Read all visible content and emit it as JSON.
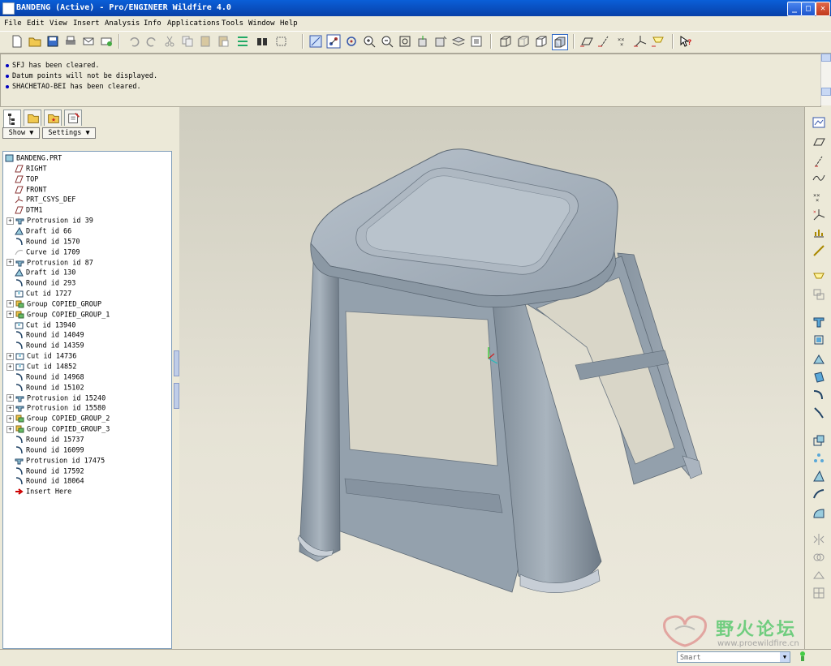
{
  "window": {
    "title": "BANDENG (Active) - Pro/ENGINEER Wildfire 4.0"
  },
  "menu": [
    "File",
    "Edit",
    "View",
    "Insert",
    "Analysis",
    "Info",
    "Applications",
    "Tools",
    "Window",
    "Help"
  ],
  "messages": [
    "SFJ has been cleared.",
    "Datum points will not be displayed.",
    "SHACHETAO-BEI has been cleared."
  ],
  "panel": {
    "show_label": "Show ▼",
    "settings_label": "Settings ▼"
  },
  "tree": [
    {
      "label": "BANDENG.PRT",
      "icon": "part-icon",
      "expand": false,
      "indent": 0
    },
    {
      "label": "RIGHT",
      "icon": "datum-plane-icon",
      "expand": false,
      "indent": 1
    },
    {
      "label": "TOP",
      "icon": "datum-plane-icon",
      "expand": false,
      "indent": 1
    },
    {
      "label": "FRONT",
      "icon": "datum-plane-icon",
      "expand": false,
      "indent": 1
    },
    {
      "label": "PRT_CSYS_DEF",
      "icon": "csys-icon",
      "expand": false,
      "indent": 1
    },
    {
      "label": "DTM1",
      "icon": "datum-plane-icon",
      "expand": false,
      "indent": 1
    },
    {
      "label": "Protrusion id 39",
      "icon": "protrusion-icon",
      "expand": true,
      "indent": 1
    },
    {
      "label": "Draft id 66",
      "icon": "draft-icon",
      "expand": false,
      "indent": 1
    },
    {
      "label": "Round id 1570",
      "icon": "round-icon",
      "expand": false,
      "indent": 1
    },
    {
      "label": "Curve id 1709",
      "icon": "curve-icon",
      "expand": false,
      "indent": 1
    },
    {
      "label": "Protrusion id 87",
      "icon": "protrusion-icon",
      "expand": true,
      "indent": 1
    },
    {
      "label": "Draft id 130",
      "icon": "draft-icon",
      "expand": false,
      "indent": 1
    },
    {
      "label": "Round id 293",
      "icon": "round-icon",
      "expand": false,
      "indent": 1
    },
    {
      "label": "Cut id 1727",
      "icon": "cut-icon",
      "expand": false,
      "indent": 1
    },
    {
      "label": "Group COPIED_GROUP",
      "icon": "group-icon",
      "expand": true,
      "indent": 1
    },
    {
      "label": "Group COPIED_GROUP_1",
      "icon": "group-icon",
      "expand": true,
      "indent": 1
    },
    {
      "label": "Cut id 13940",
      "icon": "cut-icon",
      "expand": false,
      "indent": 1
    },
    {
      "label": "Round id 14049",
      "icon": "round-icon",
      "expand": false,
      "indent": 1
    },
    {
      "label": "Round id 14359",
      "icon": "round-icon",
      "expand": false,
      "indent": 1
    },
    {
      "label": "Cut id 14736",
      "icon": "cut-icon",
      "expand": true,
      "indent": 1
    },
    {
      "label": "Cut id 14852",
      "icon": "cut-icon",
      "expand": true,
      "indent": 1
    },
    {
      "label": "Round id 14968",
      "icon": "round-icon",
      "expand": false,
      "indent": 1
    },
    {
      "label": "Round id 15102",
      "icon": "round-icon",
      "expand": false,
      "indent": 1
    },
    {
      "label": "Protrusion id 15240",
      "icon": "protrusion-icon",
      "expand": true,
      "indent": 1
    },
    {
      "label": "Protrusion id 15580",
      "icon": "protrusion-icon",
      "expand": true,
      "indent": 1
    },
    {
      "label": "Group COPIED_GROUP_2",
      "icon": "group-icon",
      "expand": true,
      "indent": 1
    },
    {
      "label": "Group COPIED_GROUP_3",
      "icon": "group-icon",
      "expand": true,
      "indent": 1
    },
    {
      "label": "Round id 15737",
      "icon": "round-icon",
      "expand": false,
      "indent": 1
    },
    {
      "label": "Round id 16099",
      "icon": "round-icon",
      "expand": false,
      "indent": 1
    },
    {
      "label": "Protrusion id 17475",
      "icon": "protrusion-icon",
      "expand": false,
      "indent": 1
    },
    {
      "label": "Round id 17592",
      "icon": "round-icon",
      "expand": false,
      "indent": 1
    },
    {
      "label": "Round id 18064",
      "icon": "round-icon",
      "expand": false,
      "indent": 1
    },
    {
      "label": "Insert Here",
      "icon": "insert-here-icon",
      "expand": false,
      "indent": 1
    }
  ],
  "status": {
    "filter": "Smart"
  },
  "watermark": {
    "text": "野火论坛",
    "url": "www.proewildfire.cn"
  },
  "colors": {
    "titlebar": "#0a5fd8",
    "viewport_bg": "#d8d6c8",
    "model": "#8c9aa8"
  }
}
